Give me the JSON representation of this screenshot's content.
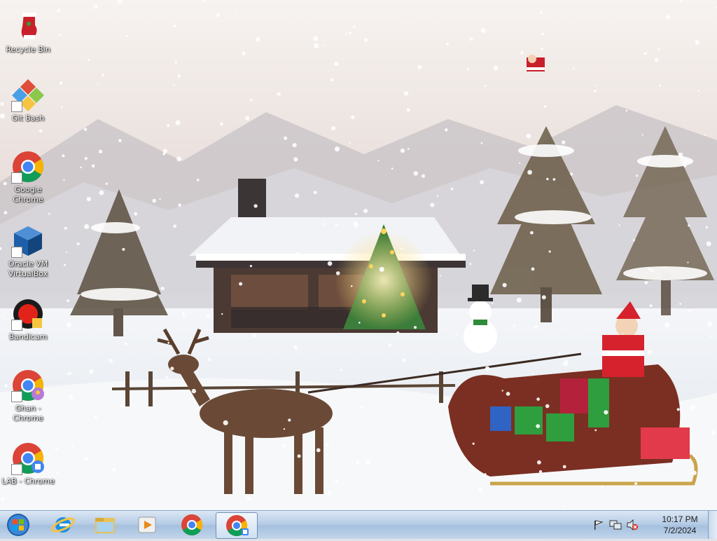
{
  "desktop": {
    "icons": [
      {
        "label": "Recycle Bin",
        "icon": "recycle-bin-icon"
      },
      {
        "label": "Git Bash",
        "icon": "git-bash-icon"
      },
      {
        "label": "Google Chrome",
        "icon": "chrome-icon"
      },
      {
        "label": "Oracle VM VirtualBox",
        "icon": "virtualbox-icon"
      },
      {
        "label": "Bandicam",
        "icon": "bandicam-icon"
      },
      {
        "label": "Ghan - Chrome",
        "icon": "chrome-profile-icon"
      },
      {
        "label": "LAB - Chrome",
        "icon": "chrome-profile-icon"
      }
    ]
  },
  "taskbar": {
    "items": [
      {
        "name": "start",
        "icon": "windows-start-orb-icon"
      },
      {
        "name": "internet-explorer",
        "icon": "internet-explorer-icon"
      },
      {
        "name": "file-explorer",
        "icon": "folder-icon"
      },
      {
        "name": "media-player",
        "icon": "media-player-icon"
      },
      {
        "name": "chrome",
        "icon": "chrome-icon"
      },
      {
        "name": "chrome-profile",
        "icon": "chrome-profile-icon",
        "active": true
      }
    ],
    "tray": {
      "icons": [
        "flag-icon",
        "network-icon",
        "volume-muted-icon"
      ],
      "time": "10:17 PM",
      "date": "7/2/2024"
    }
  },
  "colors": {
    "taskbar": "#b7cde6",
    "chrome_red": "#db4437",
    "chrome_yellow": "#f4b400",
    "chrome_green": "#0f9d58",
    "chrome_blue": "#4285f4"
  }
}
